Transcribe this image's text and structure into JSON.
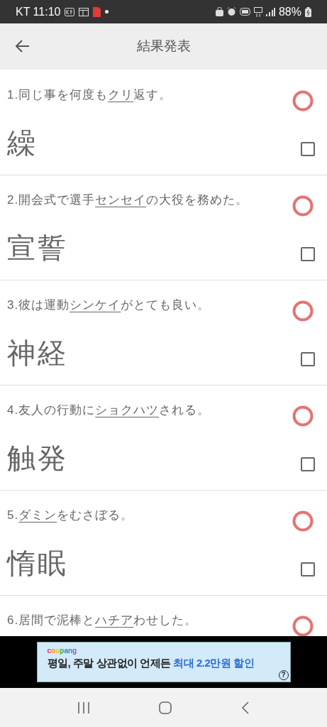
{
  "status_bar": {
    "carrier_time": "KT 11:10",
    "battery": "88%"
  },
  "header": {
    "title": "結果発表"
  },
  "questions": [
    {
      "number": "1.",
      "before": "同じ事を何度も",
      "underlined": "クリ",
      "after": "返す。",
      "correct": true,
      "answer": "繰",
      "checked": false
    },
    {
      "number": "2.",
      "before": "開会式で選手",
      "underlined": "センセイ",
      "after": "の大役を務めた。",
      "correct": true,
      "answer": "宣誓",
      "checked": false
    },
    {
      "number": "3.",
      "before": "彼は運動",
      "underlined": "シンケイ",
      "after": "がとても良い。",
      "correct": true,
      "answer": "神経",
      "checked": false
    },
    {
      "number": "4.",
      "before": "友人の行動に",
      "underlined": "ショクハツ",
      "after": "される。",
      "correct": true,
      "answer": "触発",
      "checked": false
    },
    {
      "number": "5.",
      "underlined": "ダミン",
      "after": "をむさぼる。",
      "correct": true,
      "answer": "惰眠",
      "checked": false
    },
    {
      "number": "6.",
      "before": "居間で泥棒と",
      "underlined": "ハチア",
      "after": "わせした。",
      "correct": true
    }
  ],
  "ad": {
    "brand": "coupang",
    "text": "평일, 주말 상관없이 언제든 ",
    "highlight": "최대 2.2만원 할인",
    "help": "?"
  }
}
